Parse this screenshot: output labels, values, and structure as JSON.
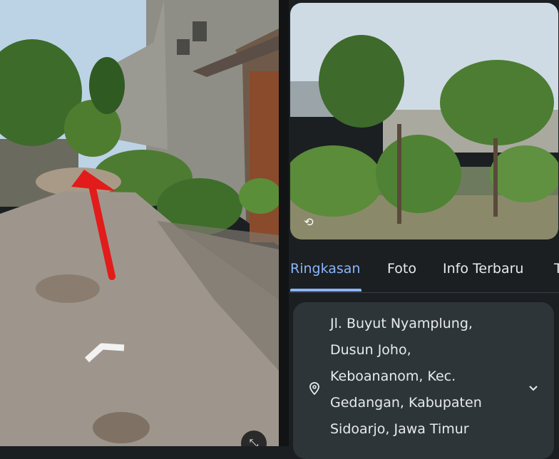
{
  "streetview": {
    "nav_arrow_icon": "chevron-up-icon",
    "annotation_arrow_color": "#e21b1b",
    "compass_icon": "compass-icon"
  },
  "panel": {
    "photo_icon": "street-view-rotate-icon",
    "tabs": [
      {
        "label": "Ringkasan",
        "active": true
      },
      {
        "label": "Foto",
        "active": false
      },
      {
        "label": "Info Terbaru",
        "active": false
      },
      {
        "label": "T",
        "active": false
      }
    ],
    "address": {
      "icon": "location-pin-icon",
      "lines": [
        "Jl. Buyut Nyamplung,",
        "Dusun Joho,",
        "Keboananom, Kec.",
        "Gedangan, Kabupaten",
        "Sidoarjo, Jawa Timur"
      ],
      "expand_icon": "chevron-down-icon"
    },
    "accent_color": "#8ab4f8"
  }
}
